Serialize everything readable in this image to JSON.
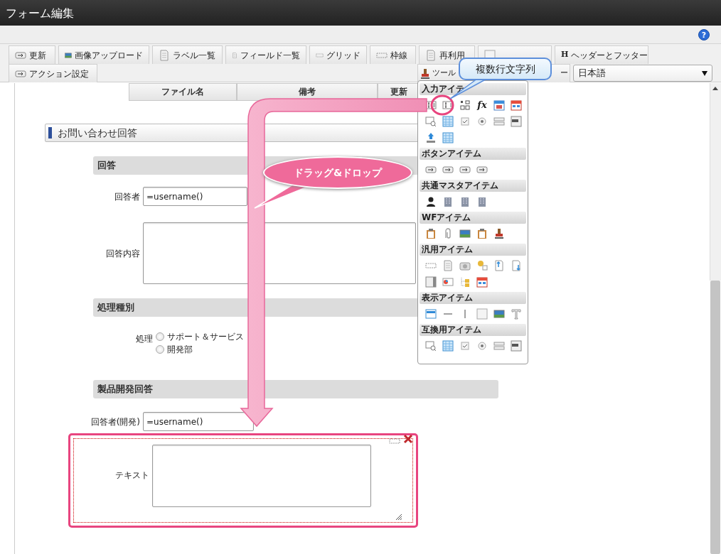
{
  "window": {
    "title": "フォーム編集"
  },
  "help_button": "?",
  "toolbar": {
    "tabs": [
      {
        "kind": "text",
        "label": "更新"
      },
      {
        "kind": "text",
        "label": "画像アップロード"
      },
      {
        "kind": "text",
        "label": "ラベル一覧"
      },
      {
        "kind": "text",
        "label": "フィールド一覧"
      },
      {
        "kind": "text",
        "label": "グリッド"
      },
      {
        "kind": "text",
        "label": "枠線"
      },
      {
        "kind": "text",
        "label": "再利用"
      },
      {
        "kind": "covered"
      },
      {
        "kind": "glyph",
        "glyph": "H",
        "label": "ヘッダーとフッター"
      }
    ],
    "action_button": "アクション設定",
    "tool_button": {
      "label_start": "ツール",
      "label_end": "ー"
    },
    "language_select": {
      "value": "日本語"
    }
  },
  "table_header": [
    "ファイル名",
    "備考",
    "更新"
  ],
  "form": {
    "title": "お問い合わせ回答",
    "sections": [
      {
        "title": "回答",
        "fields": [
          {
            "kind": "input",
            "label": "回答者",
            "value": "=username()"
          },
          {
            "kind": "textarea",
            "label": "回答内容"
          }
        ]
      },
      {
        "title": "処理種別",
        "fields": [
          {
            "kind": "radio",
            "label": "処理",
            "options": [
              {
                "label": "サポート＆サービス",
                "selected": false
              },
              {
                "label": "開発部",
                "selected": false
              }
            ]
          }
        ]
      },
      {
        "title": "製品開発回答",
        "fields": [
          {
            "kind": "input",
            "label": "回答者(開発)",
            "value": "=username()"
          }
        ]
      }
    ]
  },
  "new_item": {
    "label": "テキスト",
    "selected": true
  },
  "palette": {
    "sections": [
      {
        "title": "入力アイテ",
        "symbols": [
          "fx"
        ]
      },
      {
        "title": "ボタンアイテム"
      },
      {
        "title": "共通マスタアイテム"
      },
      {
        "title": "WFアイテム"
      },
      {
        "title": "汎用アイテム"
      },
      {
        "title": "表示アイテム"
      },
      {
        "title": "互換用アイテム"
      }
    ]
  },
  "tooltip_callout": "複数行文字列",
  "drag_callout": "ドラッグ&ドロップ"
}
